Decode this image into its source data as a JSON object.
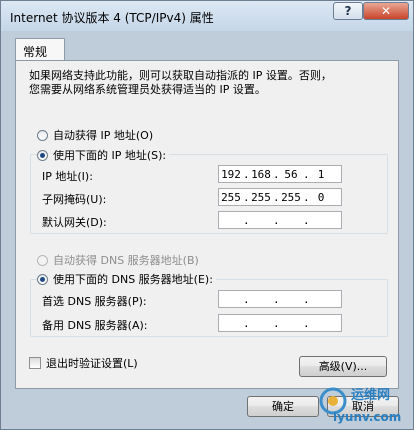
{
  "window": {
    "title": "Internet 协议版本 4 (TCP/IPv4) 属性",
    "help_label": "?",
    "close_label": "✕"
  },
  "tab": {
    "label": "常规"
  },
  "description": "如果网络支持此功能，则可以获取自动指派的 IP 设置。否则，\n您需要从网络系统管理员处获得适当的 IP 设置。",
  "ip_section": {
    "auto_label": "自动获得 IP 地址(O)",
    "manual_label": "使用下面的 IP 地址(S):",
    "selected": "manual",
    "fields": {
      "ip": {
        "label": "IP 地址(I):",
        "octets": [
          "192",
          "168",
          "56",
          "1"
        ]
      },
      "mask": {
        "label": "子网掩码(U):",
        "octets": [
          "255",
          "255",
          "255",
          "0"
        ]
      },
      "gateway": {
        "label": "默认网关(D):",
        "octets": [
          "",
          "",
          "",
          ""
        ]
      }
    }
  },
  "dns_section": {
    "auto_label": "自动获得 DNS 服务器地址(B)",
    "manual_label": "使用下面的 DNS 服务器地址(E):",
    "selected": "manual",
    "fields": {
      "preferred": {
        "label": "首选 DNS 服务器(P):",
        "octets": [
          "",
          "",
          "",
          ""
        ]
      },
      "alternate": {
        "label": "备用 DNS 服务器(A):",
        "octets": [
          "",
          "",
          "",
          ""
        ]
      }
    }
  },
  "validate_on_exit": {
    "label": "退出时验证设置(L)",
    "checked": false
  },
  "buttons": {
    "advanced": "高级(V)...",
    "ok": "确定",
    "cancel": "取消"
  },
  "watermark": {
    "text": "运维网",
    "url_text": "iyunv.com"
  },
  "colors": {
    "radio_dot": "#1f4a86",
    "title_bar": "#c5d6e8",
    "close_button": "#c9442a"
  }
}
